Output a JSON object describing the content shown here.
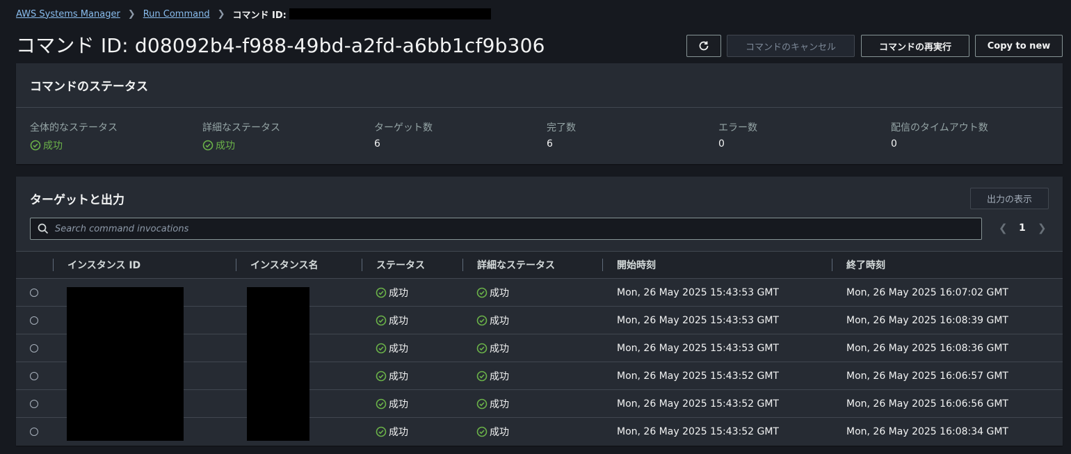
{
  "breadcrumb": {
    "root": "AWS Systems Manager",
    "section": "Run Command",
    "current": "コマンド ID:"
  },
  "header": {
    "title": "コマンド ID: d08092b4-f988-49bd-a2fd-a6bb1cf9b306",
    "refresh_icon": "refresh-icon",
    "cancel_label": "コマンドのキャンセル",
    "rerun_label": "コマンドの再実行",
    "copy_label": "Copy to new"
  },
  "status_panel": {
    "title": "コマンドのステータス",
    "stats": [
      {
        "label": "全体的なステータス",
        "value": "成功",
        "type": "success"
      },
      {
        "label": "詳細なステータス",
        "value": "成功",
        "type": "success"
      },
      {
        "label": "ターゲット数",
        "value": "6",
        "type": "plain"
      },
      {
        "label": "完了数",
        "value": "6",
        "type": "plain"
      },
      {
        "label": "エラー数",
        "value": "0",
        "type": "plain"
      },
      {
        "label": "配信のタイムアウト数",
        "value": "0",
        "type": "plain"
      }
    ]
  },
  "targets_panel": {
    "title": "ターゲットと出力",
    "show_output_label": "出力の表示",
    "search_placeholder": "Search command invocations",
    "page_number": "1",
    "columns": [
      "インスタンス ID",
      "インスタンス名",
      "ステータス",
      "詳細なステータス",
      "開始時刻",
      "終了時刻"
    ],
    "rows": [
      {
        "status": "成功",
        "detail": "成功",
        "start": "Mon, 26 May 2025 15:43:53 GMT",
        "end": "Mon, 26 May 2025 16:07:02 GMT"
      },
      {
        "status": "成功",
        "detail": "成功",
        "start": "Mon, 26 May 2025 15:43:53 GMT",
        "end": "Mon, 26 May 2025 16:08:39 GMT"
      },
      {
        "status": "成功",
        "detail": "成功",
        "start": "Mon, 26 May 2025 15:43:53 GMT",
        "end": "Mon, 26 May 2025 16:08:36 GMT"
      },
      {
        "status": "成功",
        "detail": "成功",
        "start": "Mon, 26 May 2025 15:43:52 GMT",
        "end": "Mon, 26 May 2025 16:06:57 GMT"
      },
      {
        "status": "成功",
        "detail": "成功",
        "start": "Mon, 26 May 2025 15:43:52 GMT",
        "end": "Mon, 26 May 2025 16:06:56 GMT"
      },
      {
        "status": "成功",
        "detail": "成功",
        "start": "Mon, 26 May 2025 15:43:52 GMT",
        "end": "Mon, 26 May 2025 16:08:34 GMT"
      }
    ]
  },
  "colors": {
    "background": "#16191f",
    "panel": "#262b33",
    "link": "#89bdee",
    "success": "#6bb349"
  }
}
